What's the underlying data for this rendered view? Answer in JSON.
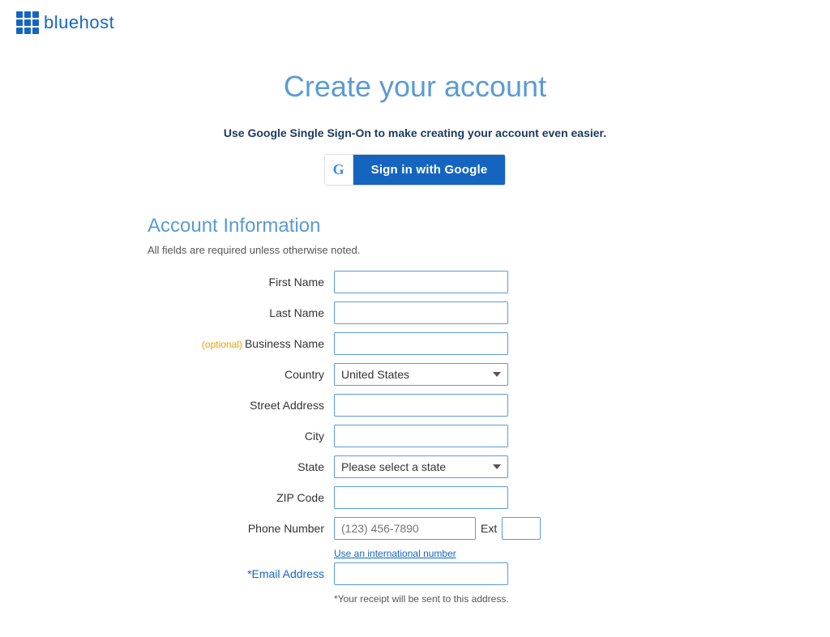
{
  "logo": {
    "text": "bluehost"
  },
  "page": {
    "title": "Create your account"
  },
  "sso": {
    "description": "Use Google Single Sign-On to make creating your account even easier.",
    "button_label": "Sign in with Google"
  },
  "account_section": {
    "title": "Account Information",
    "required_note": "All fields are required unless otherwise noted.",
    "fields": {
      "first_name_label": "First Name",
      "last_name_label": "Last Name",
      "business_name_label": "Business Name",
      "business_name_optional": "(optional)",
      "country_label": "Country",
      "country_value": "United States",
      "street_address_label": "Street Address",
      "city_label": "City",
      "state_label": "State",
      "state_placeholder": "Please select a state",
      "zip_label": "ZIP Code",
      "phone_label": "Phone Number",
      "phone_placeholder": "(123) 456-7890",
      "ext_label": "Ext",
      "intl_link": "Use an international number",
      "email_label": "*Email Address",
      "email_note": "*Your receipt will be sent to this address."
    }
  }
}
